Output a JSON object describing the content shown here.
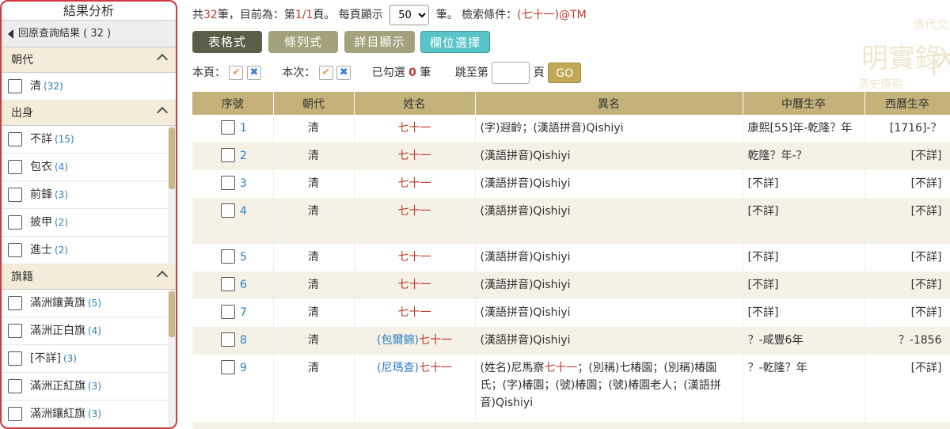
{
  "sidebar": {
    "title": "結果分析",
    "back_label": "回原查詢結果 ( 32 )",
    "sections": [
      {
        "heading": "朝代",
        "options": [
          {
            "label": "清",
            "count": "(32)"
          }
        ]
      },
      {
        "heading": "出身",
        "options": [
          {
            "label": "不詳",
            "count": "(15)"
          },
          {
            "label": "包衣",
            "count": "(4)"
          },
          {
            "label": "前鋒",
            "count": "(3)"
          },
          {
            "label": "披甲",
            "count": "(2)"
          },
          {
            "label": "進士",
            "count": "(2)"
          }
        ]
      },
      {
        "heading": "旗籍",
        "options": [
          {
            "label": "滿洲鑲黃旗",
            "count": "(5)"
          },
          {
            "label": "滿洲正白旗",
            "count": "(4)"
          },
          {
            "label": "[不詳]",
            "count": "(3)"
          },
          {
            "label": "滿洲正紅旗",
            "count": "(3)"
          },
          {
            "label": "滿洲鑲紅旗",
            "count": "(3)"
          }
        ]
      }
    ]
  },
  "summary": {
    "total_prefix": "共",
    "total": "32",
    "total_unit": "筆，目前為：第",
    "page": "1/1",
    "page_unit": "頁。 每頁顯示",
    "per_page": "50",
    "per_page_unit": "筆。 檢索條件：",
    "query": "(七十一)@TM"
  },
  "buttons": {
    "table": "表格式",
    "list": "條列式",
    "detail": "詳目顯示",
    "columns": "欄位選擇"
  },
  "controls": {
    "this_page": "本頁：",
    "this_batch": "本次：",
    "checked_prefix": "已勾選",
    "checked_count": "0",
    "checked_unit": "筆",
    "goto_prefix": "跳至第",
    "goto_unit": "頁",
    "go": "GO",
    "check_icon": "✔",
    "cross_icon": "✖"
  },
  "background": {
    "text1": "清代文",
    "text2": "明實錄",
    "text3": "清史傳稿",
    "text4": "內"
  },
  "table": {
    "headers": [
      "序號",
      "朝代",
      "姓名",
      "異名",
      "中曆生卒",
      "西曆生卒"
    ],
    "rows": [
      {
        "num": "1",
        "dyn": "清",
        "name_prefix": "",
        "name": "七十一",
        "alias": "(字)遐齡；(漢語拼音)Qishiyi",
        "cn": "康熙[55]年-乾隆？年",
        "west": "[1716]-？"
      },
      {
        "num": "2",
        "dyn": "清",
        "name_prefix": "",
        "name": "七十一",
        "alias": "(漢語拼音)Qishiyi",
        "cn": "乾隆？年-？",
        "west": "[不詳]"
      },
      {
        "num": "3",
        "dyn": "清",
        "name_prefix": "",
        "name": "七十一",
        "alias": "(漢語拼音)Qishiyi",
        "cn": "[不詳]",
        "west": "[不詳]"
      },
      {
        "num": "4",
        "dyn": "清",
        "name_prefix": "",
        "name": "七十一",
        "alias": "(漢語拼音)Qishiyi",
        "cn": "[不詳]",
        "west": "[不詳]"
      },
      {
        "num": "5",
        "dyn": "清",
        "name_prefix": "",
        "name": "七十一",
        "alias": "(漢語拼音)Qishiyi",
        "cn": "[不詳]",
        "west": "[不詳]"
      },
      {
        "num": "6",
        "dyn": "清",
        "name_prefix": "",
        "name": "七十一",
        "alias": "(漢語拼音)Qishiyi",
        "cn": "[不詳]",
        "west": "[不詳]"
      },
      {
        "num": "7",
        "dyn": "清",
        "name_prefix": "",
        "name": "七十一",
        "alias": "(漢語拼音)Qishiyi",
        "cn": "[不詳]",
        "west": "[不詳]"
      },
      {
        "num": "8",
        "dyn": "清",
        "name_prefix": "(包爾錦)",
        "name": "七十一",
        "alias": "(漢語拼音)Qishiyi",
        "cn": "？-咸豐6年",
        "west": "？-1856"
      },
      {
        "num": "9",
        "dyn": "清",
        "name_prefix": "(尼瑪查)",
        "name": "七十一",
        "alias_a": "(姓名)尼馬察",
        "alias_red": "七十一",
        "alias_b": "；(別稱)七椿園；(別稱)椿園氏；(字)椿園；(號)椿園；(號)椿園老人；(漢語拼音)Qishiyi",
        "cn": "？-乾隆？年",
        "west": "[不詳]"
      }
    ]
  }
}
